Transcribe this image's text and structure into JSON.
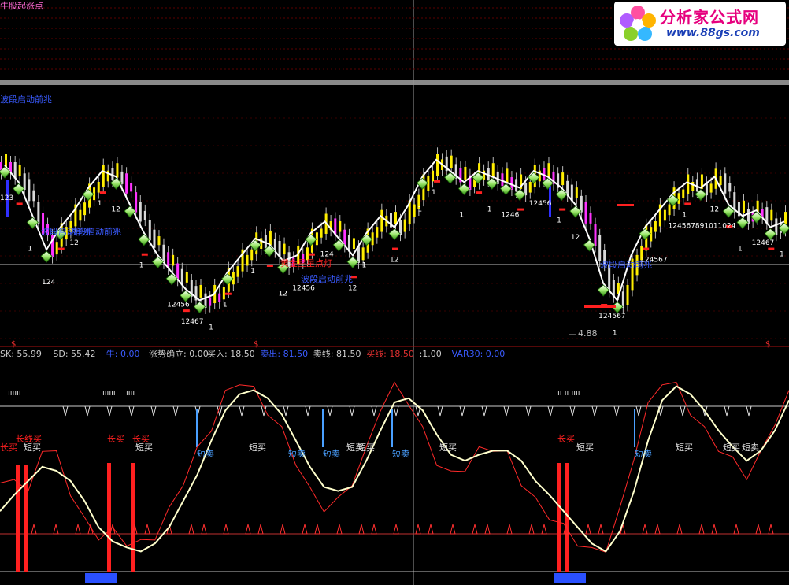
{
  "panel_titles": {
    "top": "牛股起涨点",
    "main": "波段启动前兆"
  },
  "logo": {
    "title": "分析家公式网",
    "url": "www.88gs.com"
  },
  "indicator_bar": [
    {
      "text": "SK: 55.99",
      "color": "#cccccc"
    },
    {
      "text": "SD: 55.42",
      "color": "#cccccc"
    },
    {
      "text": "牛: 0.00",
      "color": "#3a5bff"
    },
    {
      "text": "涨势确立: 0.00",
      "color": "#cccccc"
    },
    {
      "text": "买入: 18.50",
      "color": "#cccccc"
    },
    {
      "text": "卖出: 81.50",
      "color": "#3a5bff"
    },
    {
      "text": "卖线: 81.50",
      "color": "#cccccc"
    },
    {
      "text": "买线: 18.50",
      "color": "#e03030"
    },
    {
      "text": ":1.00",
      "color": "#cccccc"
    },
    {
      "text": "VAR30: 0.00",
      "color": "#3a5bff"
    }
  ],
  "colors": {
    "background": "#000000",
    "up_candle": "#ffee00",
    "down_candle": "#ff33ff",
    "price_line": "#ffffff",
    "sk_line": "#ff2a2a",
    "sd_line": "#ffffcc",
    "signal_red": "#ff2020",
    "signal_blue": "#4aa0ff",
    "separator": "#808080"
  },
  "chart_data": [
    {
      "type": "line",
      "name": "main",
      "values": [
        10.5,
        10.2,
        9.6,
        9.0,
        9.4,
        9.7,
        10.1,
        10.4,
        10.3,
        9.8,
        9.3,
        8.9,
        8.6,
        8.3,
        8.1,
        8.2,
        8.6,
        8.9,
        9.2,
        9.1,
        8.8,
        8.9,
        9.3,
        9.5,
        9.2,
        8.9,
        9.3,
        9.6,
        9.4,
        9.8,
        10.3,
        10.6,
        10.4,
        10.2,
        10.4,
        10.3,
        10.2,
        10.1,
        10.4,
        10.3,
        10.1,
        9.8,
        9.2,
        8.4,
        8.1,
        8.9,
        9.4,
        9.7,
        10.0,
        10.2,
        10.1,
        10.3,
        9.8,
        9.6,
        9.7,
        9.4,
        9.5
      ],
      "min_marker": "4.88",
      "annotations": [
        "波段启动前兆",
        "波段启动前兆",
        "黄金星星点灯",
        "波段启动前兆",
        "波段启动前兆"
      ],
      "numeric_labels": [
        "123",
        "1",
        "124",
        "12",
        "1",
        "12",
        "1",
        "12456",
        "12467",
        "1",
        "1",
        "1",
        "12",
        "12456",
        "124",
        "12",
        "1",
        "12",
        "1",
        "1",
        "1",
        "1",
        "1246",
        "12456",
        "1",
        "12",
        "124567",
        "1",
        "124567",
        "124567891011024",
        "1",
        "12",
        "1",
        "12467",
        "1"
      ]
    },
    {
      "type": "line",
      "name": "oscillator",
      "series": [
        {
          "name": "SK",
          "values": [
            42,
            48,
            38,
            62,
            58,
            40,
            25,
            18,
            20,
            15,
            14,
            18,
            30,
            45,
            60,
            72,
            88,
            95,
            90,
            80,
            70,
            55,
            40,
            32,
            35,
            45,
            60,
            82,
            92,
            85,
            70,
            55,
            48,
            52,
            60,
            62,
            58,
            45,
            35,
            28,
            22,
            15,
            10,
            12,
            30,
            58,
            82,
            95,
            92,
            80,
            70,
            62,
            55,
            48,
            58,
            75,
            88
          ]
        },
        {
          "name": "SD",
          "values": [
            30,
            38,
            45,
            52,
            50,
            45,
            35,
            22,
            15,
            12,
            10,
            14,
            22,
            35,
            48,
            65,
            80,
            88,
            90,
            86,
            78,
            65,
            52,
            42,
            40,
            42,
            55,
            70,
            84,
            86,
            80,
            68,
            58,
            55,
            58,
            60,
            60,
            55,
            45,
            38,
            30,
            22,
            14,
            10,
            20,
            40,
            65,
            85,
            92,
            88,
            80,
            70,
            62,
            55,
            60,
            70,
            85
          ]
        }
      ],
      "labels": [
        "长线买",
        "长买",
        "长买",
        "长买",
        "长买",
        "短买",
        "短买",
        "短买",
        "短买",
        "短买",
        "短买",
        "短买",
        "短买",
        "短买",
        "短卖",
        "短卖",
        "短卖",
        "短卖",
        "短卖",
        "短卖"
      ],
      "reference_lines": [
        18.5,
        81.5
      ]
    }
  ]
}
